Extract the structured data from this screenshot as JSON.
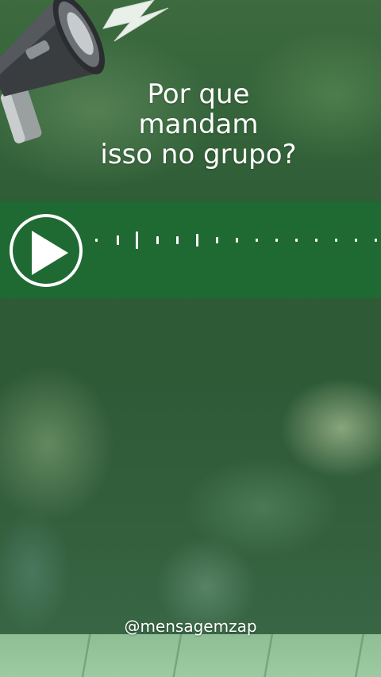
{
  "title_text": "Por que\nmandam\nisso no grupo?",
  "audio": {
    "play_icon": "play-icon",
    "waveform_icon": "waveform-icon"
  },
  "handle": "@mensagemzap",
  "colors": {
    "audio_bar": "#1f6a33",
    "text": "#ffffff",
    "background": "#2f5a36"
  },
  "decor": {
    "megaphone_icon": "megaphone-icon",
    "lightning_icon": "lightning-icon"
  }
}
